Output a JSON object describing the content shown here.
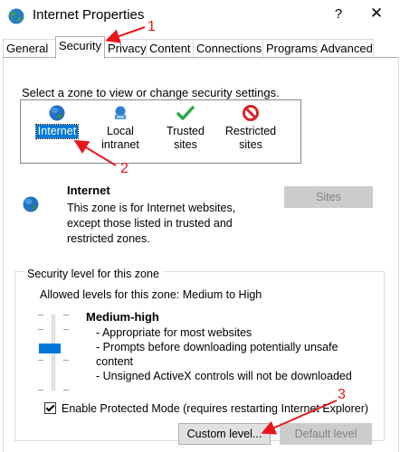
{
  "window": {
    "title": "Internet Properties",
    "help_glyph": "?",
    "close_glyph": "✕"
  },
  "tabs": [
    "General",
    "Security",
    "Privacy",
    "Content",
    "Connections",
    "Programs",
    "Advanced"
  ],
  "active_tab": "Security",
  "zones": {
    "prompt": "Select a zone to view or change security settings.",
    "items": [
      {
        "line1": "Internet",
        "line2": "",
        "icon": "globe-icon"
      },
      {
        "line1": "Local",
        "line2": "intranet",
        "icon": "intranet-icon"
      },
      {
        "line1": "Trusted",
        "line2": "sites",
        "icon": "check-icon"
      },
      {
        "line1": "Restricted",
        "line2": "sites",
        "icon": "restricted-icon"
      }
    ],
    "selected": "Internet"
  },
  "zone_info": {
    "title": "Internet",
    "desc_lines": [
      "This zone is for Internet websites,",
      "except those listed in trusted and",
      "restricted zones."
    ],
    "sites_button": "Sites"
  },
  "security_level": {
    "legend": "Security level for this zone",
    "allowed": "Allowed levels for this zone: Medium to High",
    "level_name": "Medium-high",
    "level_lines": [
      "- Appropriate for most websites",
      "- Prompts before downloading potentially unsafe",
      "content",
      "- Unsigned ActiveX controls will not be downloaded"
    ],
    "protected_mode_label": "Enable Protected Mode (requires restarting Internet Explorer)",
    "protected_mode_checked": true,
    "custom_button": "Custom level...",
    "default_button": "Default level"
  },
  "annotations": [
    "1",
    "2",
    "3"
  ],
  "colors": {
    "accent": "#0078d7",
    "annotation": "#e8161b",
    "trusted_check": "#2ca84b",
    "restricted": "#d9232a"
  }
}
